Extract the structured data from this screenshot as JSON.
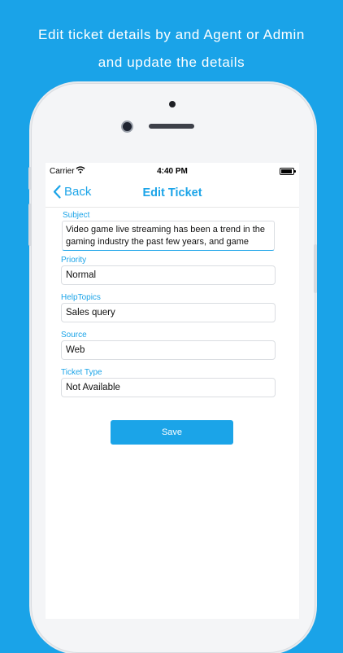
{
  "header": {
    "line1": "Edit ticket details by and Agent or Admin",
    "line2": "and update the details"
  },
  "status_bar": {
    "carrier": "Carrier",
    "time": "4:40 PM"
  },
  "nav": {
    "back_label": "Back",
    "title": "Edit Ticket"
  },
  "form": {
    "subject": {
      "label": "Subject",
      "line1": "Video game live streaming has been a trend in the",
      "line2": "gaming industry the past few years, and game"
    },
    "priority": {
      "label": "Priority",
      "value": "Normal"
    },
    "help_topics": {
      "label": "HelpTopics",
      "value": "Sales query"
    },
    "source": {
      "label": "Source",
      "value": "Web"
    },
    "ticket_type": {
      "label": "Ticket Type",
      "value": "Not Available"
    },
    "save_label": "Save"
  },
  "colors": {
    "background": "#1aa3e8",
    "accent": "#1ba4e8",
    "text": "#111111"
  },
  "icons": [
    "back-chevron-icon",
    "wifi-icon",
    "battery-icon"
  ]
}
